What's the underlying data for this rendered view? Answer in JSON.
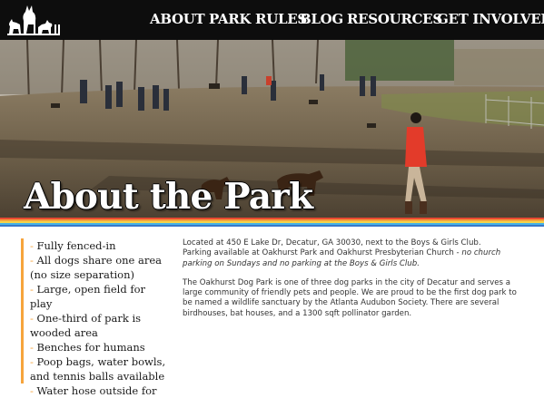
{
  "nav": {
    "items": [
      {
        "label": "ABOUT"
      },
      {
        "label": "PARK RULES"
      },
      {
        "label": "BLOG"
      },
      {
        "label": "RESOURCES"
      },
      {
        "label": "GET INVOLVED"
      }
    ]
  },
  "hero": {
    "title": "About the Park"
  },
  "stripes": {
    "colors": [
      "#e84a32",
      "#f6a43c",
      "#f7d34a",
      "#46b3e6",
      "#3a78c9"
    ]
  },
  "features": {
    "items": [
      {
        "dash": "- ",
        "text": "Fully fenced-in"
      },
      {
        "dash": "- ",
        "text": "All dogs share one area (no size separation)"
      },
      {
        "dash": "- ",
        "text": "Large, open field for play"
      },
      {
        "dash": "- ",
        "text": "One-third of park is wooded area"
      },
      {
        "dash": "- ",
        "text": "Benches for humans"
      },
      {
        "dash": "- ",
        "text": "Poop bags, water bowls, and tennis balls available"
      },
      {
        "dash": "- ",
        "text": "Water hose outside for"
      }
    ]
  },
  "info": {
    "location": {
      "line1": "Located at 450 E Lake Dr, Decatur, GA 30030, next to the Boys & Girls Club.",
      "line2": "Parking available at Oakhurst Park and Oakhurst Presbyterian Church - ",
      "note": "no church parking on Sundays and no parking at the Boys & Girls Club."
    },
    "about": "The Oakhurst Dog Park is one of three dog parks in the city of Decatur and serves a large community of friendly pets and people. We are proud to be the first dog park to be named a wildlife sanctuary by the Atlanta Audubon Society. There are several birdhouses, bat houses, and a 1300 sqft pollinator garden."
  }
}
